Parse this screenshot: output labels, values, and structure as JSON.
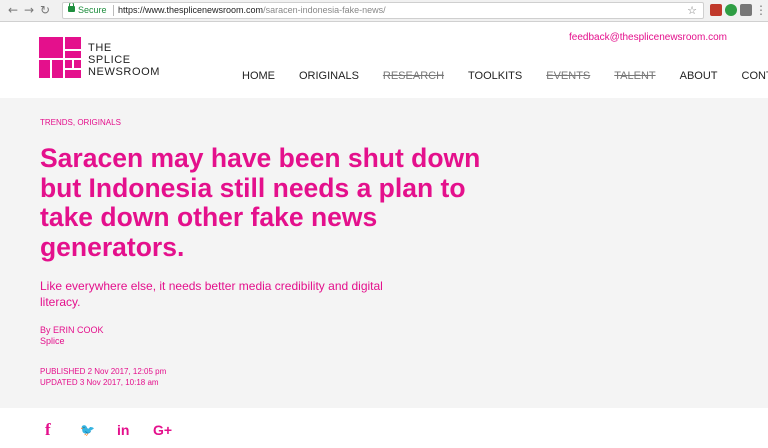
{
  "browser": {
    "secure_label": "Secure",
    "url_host": "https://www.thesplicenewsroom.com",
    "url_path": "/saracen-indonesia-fake-news/"
  },
  "site": {
    "logo_lines": [
      "THE",
      "SPLICE",
      "NEWSROOM"
    ],
    "feedback_email": "feedback@thesplicenewsroom.com",
    "brand_color": "#e4108c",
    "nav": [
      {
        "label": "HOME",
        "strikethrough": false
      },
      {
        "label": "ORIGINALS",
        "strikethrough": false
      },
      {
        "label": "RESEARCH",
        "strikethrough": true
      },
      {
        "label": "TOOLKITS",
        "strikethrough": false
      },
      {
        "label": "EVENTS",
        "strikethrough": true
      },
      {
        "label": "TALENT",
        "strikethrough": true
      },
      {
        "label": "ABOUT",
        "strikethrough": false
      },
      {
        "label": "CONTACT",
        "strikethrough": false
      }
    ]
  },
  "article": {
    "categories": "TRENDS, ORIGINALS",
    "headline_lines": [
      "Saracen may have been shut down",
      "but Indonesia still needs a plan to",
      "take down other fake news",
      "generators."
    ],
    "subtitle_lines": [
      "Like everywhere else, it needs better media credibility and digital",
      "literacy."
    ],
    "byline": "By ERIN COOK",
    "publication": "Splice",
    "published": "PUBLISHED 2 Nov 2017, 12:05 pm",
    "updated": "UPDATED 3 Nov 2017, 10:18 am"
  },
  "share": {
    "facebook": "f",
    "twitter": "🐦",
    "linkedin": "in",
    "googleplus": "G+"
  }
}
